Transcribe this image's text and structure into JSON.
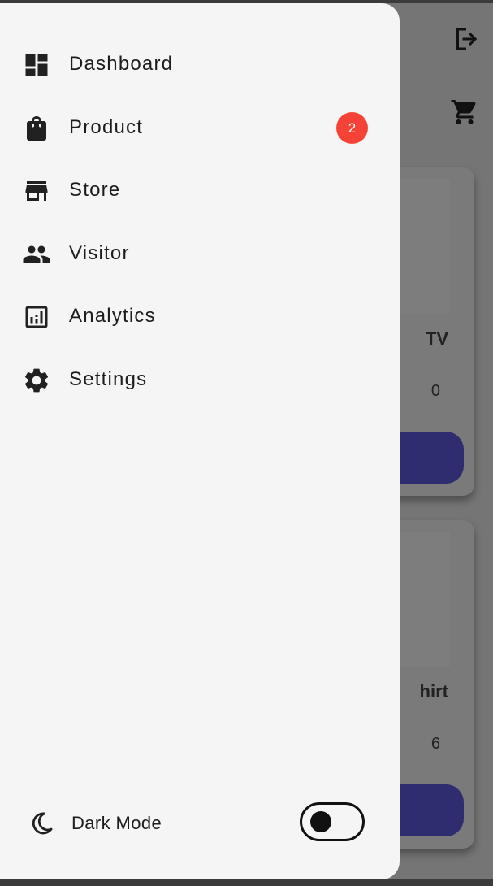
{
  "background": {
    "cards": [
      {
        "title": "TV",
        "price": "0"
      },
      {
        "title": "hirt",
        "price": "6"
      }
    ]
  },
  "drawer": {
    "items": [
      {
        "label": "Dashboard",
        "icon": "dashboard-icon"
      },
      {
        "label": "Product",
        "icon": "shopping-bag-icon",
        "badge": "2"
      },
      {
        "label": "Store",
        "icon": "store-icon"
      },
      {
        "label": "Visitor",
        "icon": "people-icon"
      },
      {
        "label": "Analytics",
        "icon": "analytics-icon"
      },
      {
        "label": "Settings",
        "icon": "gear-icon"
      }
    ],
    "dark_mode": {
      "label": "Dark Mode",
      "icon": "moon-icon",
      "enabled": false
    }
  },
  "colors": {
    "badge": "#f44336",
    "button": "#2f2d70",
    "drawer_bg": "#f5f5f5",
    "scrim": "#757575"
  }
}
